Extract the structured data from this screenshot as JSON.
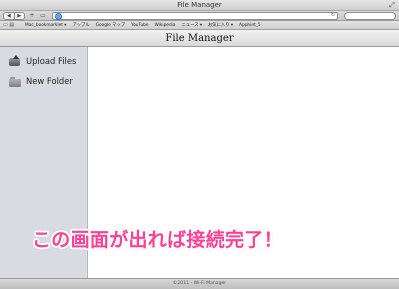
{
  "window": {
    "title": "File Manager"
  },
  "toolbar": {
    "back_icon": "◀",
    "forward_icon": "▶",
    "add_icon": "+",
    "reader_icon": "▭",
    "reload_icon": "↻"
  },
  "bookmarks": {
    "items": [
      "Mac_bookmarklet ▾",
      "アップル",
      "Google マップ",
      "YouTube",
      "Wikipedia",
      "ニュース ▾",
      "お気に入り ▾",
      "Apphint_5"
    ],
    "icon_text": "▭ ▤"
  },
  "app": {
    "header_title": "File Manager"
  },
  "sidebar": {
    "items": [
      {
        "label": "Upload Files",
        "icon": "upload-icon"
      },
      {
        "label": "New Folder",
        "icon": "folder-icon"
      }
    ]
  },
  "footer": {
    "text": "©2011 - Wi-Fi Manager"
  },
  "caption": {
    "text": "この画面が出れば接続完了！",
    "color": "#ff3f94"
  }
}
